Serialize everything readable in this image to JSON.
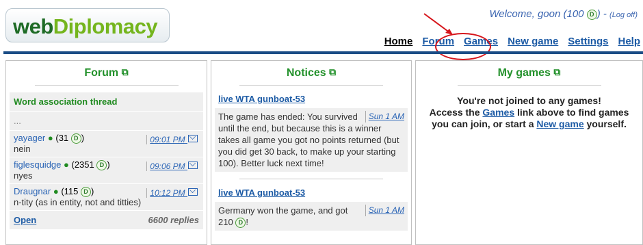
{
  "header": {
    "logo_web": "web",
    "logo_diplomacy": "Diplomacy",
    "welcome_prefix": "Welcome, ",
    "username": "goon",
    "points_open": " (100 ",
    "points_close": ")",
    "separator": " - ",
    "logoff": "(Log off)",
    "coin_icon": "D"
  },
  "nav": {
    "items": [
      "Home",
      "Forum",
      "Games",
      "New game",
      "Settings",
      "Help"
    ]
  },
  "annotation": {
    "arrow_color": "#d6141a",
    "highlight": "Games"
  },
  "forum": {
    "title": "Forum",
    "thread_title": "Word association thread",
    "ellipsis": "...",
    "posts": [
      {
        "user": "yayager",
        "points": "(31 ",
        "points_close": ")",
        "time": "09:01 PM",
        "message": "nein"
      },
      {
        "user": "figlesquidge",
        "points": "(2351 ",
        "points_close": ")",
        "time": "09:06 PM",
        "message": "nyes"
      },
      {
        "user": "Draugnar",
        "points": "(115 ",
        "points_close": ")",
        "time": "10:12 PM",
        "message": "n-tity (as in entity, not and titties)"
      }
    ],
    "open_label": "Open",
    "replies": "6600 replies"
  },
  "notices": {
    "title": "Notices",
    "items": [
      {
        "title": "live WTA gunboat-53",
        "time": "Sun 1 AM",
        "body": "The game has ended: You survived until the end, but because this is a winner takes all game you got no points returned (but you did get 30 back, to make up your starting 100). Better luck next time!"
      },
      {
        "title": "live WTA gunboat-53",
        "time": "Sun 1 AM",
        "body": "Germany won the game, and got 210 ",
        "body_end": "!"
      }
    ]
  },
  "mygames": {
    "title": "My games",
    "line1": "You're not joined to any games!",
    "line2_a": "Access the ",
    "games_link": "Games",
    "line2_b": " link above to find games you can join, or start a ",
    "new_link": "New game",
    "line2_c": " yourself."
  },
  "colors": {
    "brand_green": "#1e6b26",
    "link_blue": "#1d5ba5",
    "header_bar": "#1b4d86",
    "heading_green": "#23912b"
  }
}
